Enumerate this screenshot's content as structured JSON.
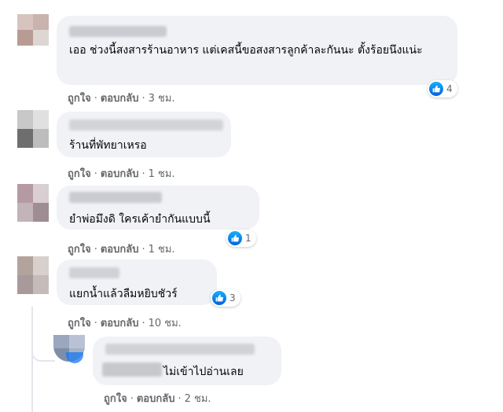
{
  "colors": {
    "bubble": "#f0f2f5",
    "action_text": "#65676b",
    "like_blue": "#1877f2"
  },
  "comments": [
    {
      "text": "เออ ช่วงนี้สงสารร้านอาหาร แต่เคสนี้ขอสงสารลูกค้าละกันนะ ตั้งร้อยนึงแน่ะ",
      "reaction_count": "4",
      "like_label": "ถูกใจ",
      "reply_label": "ตอบกลับ",
      "time": "3 ชม."
    },
    {
      "text": "ร้านที่พัทยาเหรอ",
      "like_label": "ถูกใจ",
      "reply_label": "ตอบกลับ",
      "time": "1 ชม."
    },
    {
      "text": "ยำพ่อมึงดิ ใครเค้ายำกันแบบนี้",
      "reaction_count": "1",
      "like_label": "ถูกใจ",
      "reply_label": "ตอบกลับ",
      "time": "1 ชม."
    },
    {
      "text": "แยกน้ำแล้วลืมหยิบชัวร์",
      "reaction_count": "3",
      "like_label": "ถูกใจ",
      "reply_label": "ตอบกลับ",
      "time": "10 ชม."
    },
    {
      "text": "ไม่เข้าไปอ่านเลย",
      "like_label": "ถูกใจ",
      "reply_label": "ตอบกลับ",
      "time": "2 ชม."
    }
  ],
  "separator": "·",
  "icons": {
    "reaction": "like-thumb-icon",
    "avatar": "avatar",
    "reply_badge": "blue-badge"
  }
}
